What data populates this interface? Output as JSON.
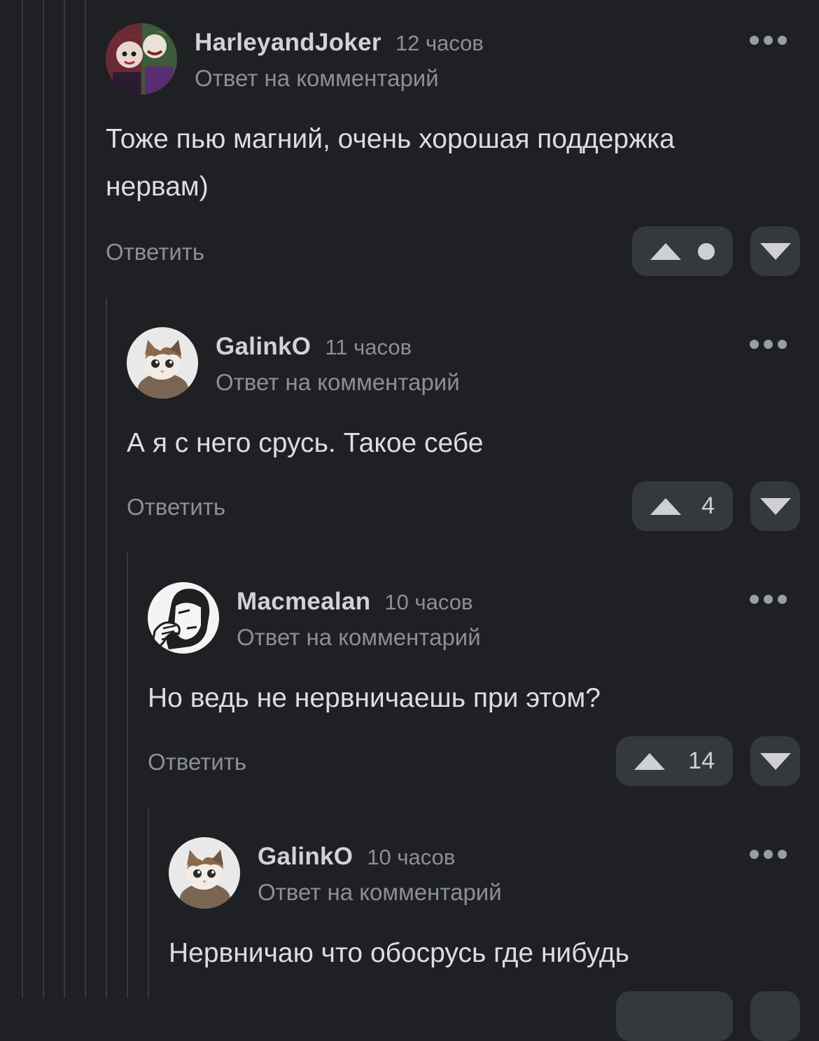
{
  "comments": [
    {
      "author": "HarleyandJoker",
      "time": "12 часов",
      "reply_to": "Ответ на комментарий",
      "text_lines": [
        "Тоже пью магний, очень хорошая поддержка",
        "нервам)"
      ],
      "reply_label": "Ответить",
      "rating": ""
    },
    {
      "author": "GalinkO",
      "time": "11 часов",
      "reply_to": "Ответ на комментарий",
      "text_lines": [
        "А я с него срусь. Такое себе"
      ],
      "reply_label": "Ответить",
      "rating": "4"
    },
    {
      "author": "Macmealan",
      "time": "10 часов",
      "reply_to": "Ответ на комментарий",
      "text_lines": [
        "Но ведь не нервничаешь при этом?"
      ],
      "reply_label": "Ответить",
      "rating": "14"
    },
    {
      "author": "GalinkO",
      "time": "10 часов",
      "reply_to": "Ответ на комментарий",
      "text_lines": [
        "Нервничаю что обосрусь где нибудь"
      ]
    }
  ],
  "icons": {
    "vote_up": "triangle-up-icon",
    "vote_down": "triangle-down-icon",
    "more": "more-dots-icon",
    "hidden_rating": "dot-icon"
  },
  "colors": {
    "background": "#1e2023",
    "button": "#35383c",
    "muted_text": "#8c8f94",
    "thread_line": "#36393d"
  }
}
